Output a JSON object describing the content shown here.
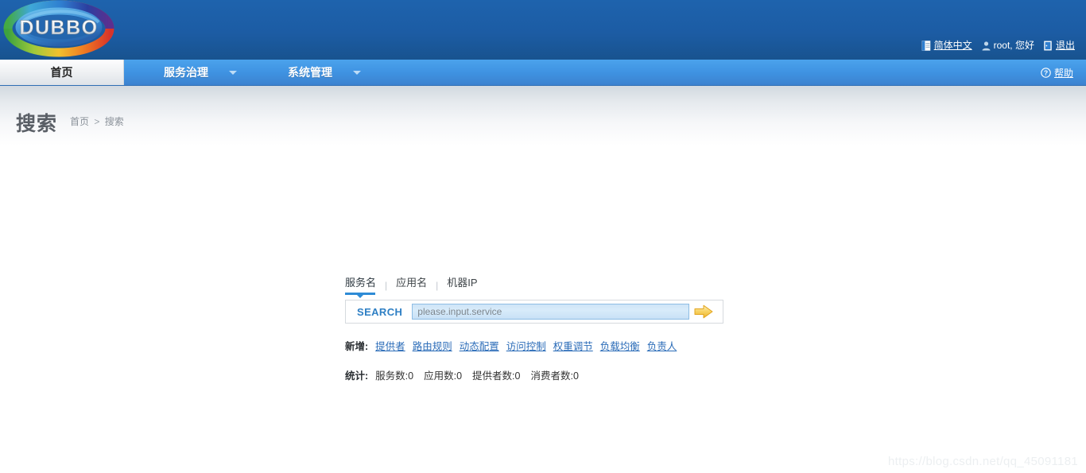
{
  "header": {
    "logo_text": "DUBBO",
    "logo_icon": "dubbo-ring-logo",
    "user_bar": {
      "language": {
        "label": "简体中文",
        "icon": "language-page-icon"
      },
      "greeting": {
        "label": "root, 您好",
        "icon": "user-icon"
      },
      "logout": {
        "label": "退出",
        "icon": "logout-door-icon"
      }
    }
  },
  "nav": {
    "home": "首页",
    "items": [
      {
        "label": "服务治理",
        "caret": "chevron-down-icon"
      },
      {
        "label": "系统管理",
        "caret": "chevron-down-icon"
      }
    ],
    "help": {
      "label": "帮助",
      "icon": "question-circle-icon"
    }
  },
  "page": {
    "title": "搜索",
    "breadcrumb": {
      "root": "首页",
      "separator": ">",
      "current": "搜索"
    }
  },
  "search": {
    "tabs": [
      {
        "label": "服务名",
        "active": true
      },
      {
        "label": "应用名",
        "active": false
      },
      {
        "label": "机器IP",
        "active": false
      }
    ],
    "tab_separator": "|",
    "search_label": "SEARCH",
    "input_value": "",
    "placeholder": "please.input.service",
    "submit_icon": "yellow-arrow-right-icon"
  },
  "create": {
    "label": "新增:",
    "links": [
      "提供者",
      "路由规则",
      "动态配置",
      "访问控制",
      "权重调节",
      "负载均衡",
      "负责人"
    ]
  },
  "stats": {
    "label": "统计:",
    "items": [
      "服务数:0",
      "应用数:0",
      "提供者数:0",
      "消费者数:0"
    ]
  },
  "watermark": "https://blog.csdn.net/qq_45091181",
  "colors": {
    "header_blue": "#1c5ca4",
    "nav_blue": "#3f93e2",
    "link_blue": "#2b6cb8",
    "search_label_blue": "#2e7fc4",
    "tab_accent": "#2e8bd6",
    "arrow_gold": "#f5c442"
  }
}
